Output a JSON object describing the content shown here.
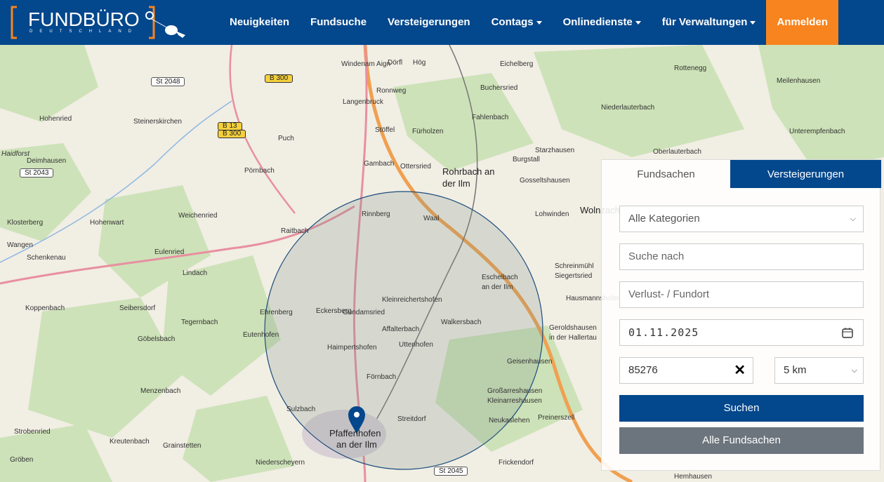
{
  "logo": {
    "title": "FUNDBÜRO",
    "subtitle": "DEUTSCHLAND"
  },
  "nav": {
    "items": [
      {
        "label": "Neuigkeiten",
        "dropdown": false
      },
      {
        "label": "Fundsuche",
        "dropdown": false
      },
      {
        "label": "Versteigerungen",
        "dropdown": false
      },
      {
        "label": "Contags",
        "dropdown": true
      },
      {
        "label": "Onlinedienste",
        "dropdown": true
      },
      {
        "label": "für Verwaltungen",
        "dropdown": true
      }
    ],
    "login": "Anmelden"
  },
  "colors": {
    "brand": "#03478c",
    "accent": "#f7841f",
    "secondary": "#6c757d"
  },
  "map": {
    "places": [
      "Windenam Aign",
      "Dörfl",
      "Hög",
      "Eichelberg",
      "Rottenegg",
      "Meilenhausen",
      "Ronnweg",
      "Langenbruck",
      "Buchersried",
      "Niederlauterbach",
      "Hohenried",
      "Steinerskirchen",
      "Fahlenbach",
      "Stöffel",
      "Fürholzen",
      "Unterempfenbach",
      "Puch",
      "Starzhausen",
      "Oberlauterbach",
      "Deimhausen",
      "Gambach",
      "Ottersried",
      "Burgstall",
      "Pörnbach",
      "Rohrbach an",
      "der Ilm",
      "Gosseltshausen",
      "Wolnzach",
      "Weichenried",
      "Rinnberg",
      "Waal",
      "Lohwinden",
      "Klosterberg",
      "Raitbach",
      "Hohenwart",
      "Wangen",
      "Schenkenau",
      "Eulenried",
      "Lindach",
      "Gundamsried",
      "Eschelbach",
      "an der Ilm",
      "Schreinmühl",
      "Siegertsried",
      "Koppenbach",
      "Seibersdorf",
      "Ehrenberg",
      "Eckersberg",
      "Kleinreichertshofen",
      "Hausmannshofen",
      "Tegernbach",
      "Affalterbach",
      "Walkersbach",
      "Geroldshausen",
      "in der Hallertau",
      "Eutenhofen",
      "Göbelsbach",
      "Haimpertshofen",
      "Uttenhofen",
      "Geisenhausen",
      "Menzenbach",
      "Förnbach",
      "Großarreshausen",
      "Kleinarreshausen",
      "Sulzbach",
      "Streitdorf",
      "Preinerszell",
      "Strobenried",
      "Neukaslehen",
      "Pfaffenhofen",
      "an der Ilm",
      "Kreutenbach",
      "Grainstetten",
      "Gröben",
      "Niederscheyern",
      "Frickendorf",
      "Hemhausen",
      "Haidforst"
    ],
    "roads": [
      "St 2048",
      "B 300",
      "B 13",
      "B 300",
      "St 2043",
      "St 2045"
    ]
  },
  "search": {
    "tabs": [
      {
        "label": "Fundsachen",
        "active": false
      },
      {
        "label": "Versteigerungen",
        "active": true
      }
    ],
    "category": "Alle Kategorien",
    "query_placeholder": "Suche nach",
    "location_placeholder": "Verlust- / Fundort",
    "date": "01.11.2025",
    "postcode": "85276",
    "radius": "5 km",
    "submit": "Suchen",
    "all": "Alle Fundsachen"
  }
}
